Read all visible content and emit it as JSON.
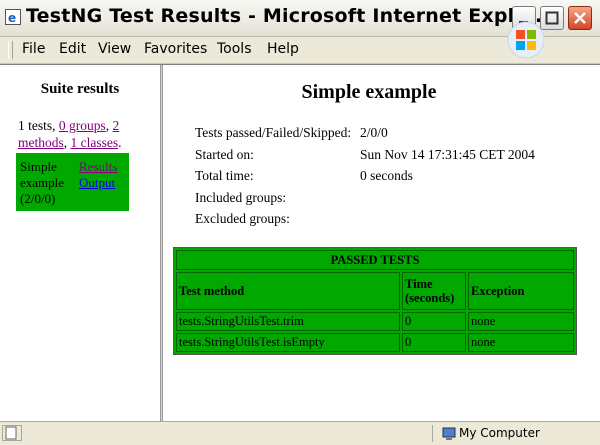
{
  "window": {
    "title": "TestNG Test Results - Microsoft Internet Explo..."
  },
  "menu": {
    "items": [
      "File",
      "Edit",
      "View",
      "Favorites",
      "Tools",
      "Help"
    ]
  },
  "left": {
    "title": "Suite results",
    "summary": {
      "tests": "1 tests,",
      "groups": "0 groups",
      "sep1": ",",
      "methods": "2 methods",
      "sep2": ",",
      "classes": "1 classes",
      "end": "."
    },
    "suite": {
      "name": "Simple example (2/0/0)",
      "results_link": "Results",
      "output_link": "Output"
    }
  },
  "main": {
    "title": "Simple example",
    "info": [
      {
        "label": "Tests passed/Failed/Skipped:",
        "value": "2/0/0"
      },
      {
        "label": "Started on:",
        "value": "Sun Nov 14 17:31:45 CET 2004"
      },
      {
        "label": "Total time:",
        "value": "0 seconds"
      },
      {
        "label": "Included groups:",
        "value": ""
      },
      {
        "label": "Excluded groups:",
        "value": ""
      }
    ],
    "table": {
      "caption": "PASSED TESTS",
      "columns": [
        "Test method",
        "Time (seconds)",
        "Exception"
      ],
      "rows": [
        [
          "tests.StringUtilsTest.trim",
          "0",
          "none"
        ],
        [
          "tests.StringUtilsTest.isEmpty",
          "0",
          "none"
        ]
      ]
    }
  },
  "status": {
    "zone": "My Computer"
  },
  "colors": {
    "pass_green": "#00a800"
  }
}
